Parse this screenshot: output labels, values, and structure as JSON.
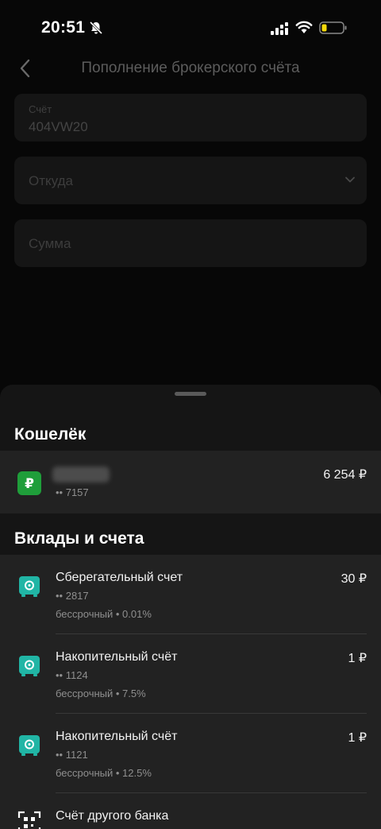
{
  "status": {
    "time": "20:51"
  },
  "header": {
    "title": "Пополнение брокерского счёта"
  },
  "form": {
    "account_label": "Счёт",
    "account_value": "404VW20",
    "from_placeholder": "Откуда",
    "amount_placeholder": "Сумма"
  },
  "sheet": {
    "wallet_title": "Кошелёк",
    "wallet": {
      "number": "•• 7157",
      "amount": "6 254 ₽",
      "icon": "ruble-wallet-icon",
      "icon_color": "#1f9e3a"
    },
    "deposits_title": "Вклады и счета",
    "accounts": [
      {
        "name": "Сберегательный счет",
        "number": "•• 2817",
        "terms": "бессрочный • 0.01%",
        "amount": "30 ₽",
        "icon": "safe-icon"
      },
      {
        "name": "Накопительный счёт",
        "number": "•• 1124",
        "terms": "бессрочный • 7.5%",
        "amount": "1 ₽",
        "icon": "safe-icon"
      },
      {
        "name": "Накопительный счёт",
        "number": "•• 1121",
        "terms": "бессрочный • 12.5%",
        "amount": "1 ₽",
        "icon": "safe-icon"
      },
      {
        "name": "Счёт другого банка",
        "icon": "qr-code-icon"
      }
    ],
    "accent_color": "#21b5a5"
  }
}
